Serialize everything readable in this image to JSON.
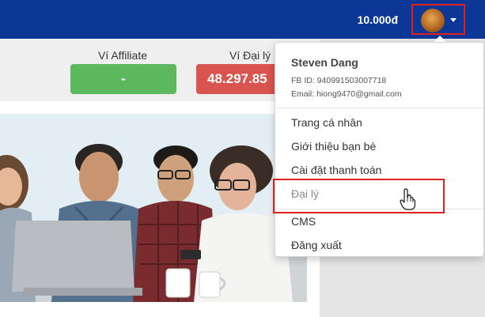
{
  "header": {
    "balance": "10.000đ",
    "avatar_icon": "user-avatar-photo",
    "caret_icon": "caret-down-icon"
  },
  "stats": {
    "affiliate": {
      "label": "Ví Affiliate",
      "value": "-"
    },
    "agency": {
      "label": "Ví Đại lý",
      "value": "48.297.85"
    }
  },
  "dropdown": {
    "user": {
      "name": "Steven Dang",
      "fb_id": "FB ID: 940991503007718",
      "email": "Email: hiong9470@gmail.com"
    },
    "items": [
      {
        "label": "Trang cá nhân"
      },
      {
        "label": "Giới thiệu bạn bè"
      },
      {
        "label": "Cài đặt thanh toán"
      },
      {
        "label": "Đại lý"
      },
      {
        "label": "CMS"
      },
      {
        "label": "Đăng xuất"
      }
    ]
  },
  "colors": {
    "header_bg": "#0c3796",
    "affiliate_green": "#5cb85c",
    "agency_red": "#d9534f",
    "highlight_red": "#e0201c"
  }
}
